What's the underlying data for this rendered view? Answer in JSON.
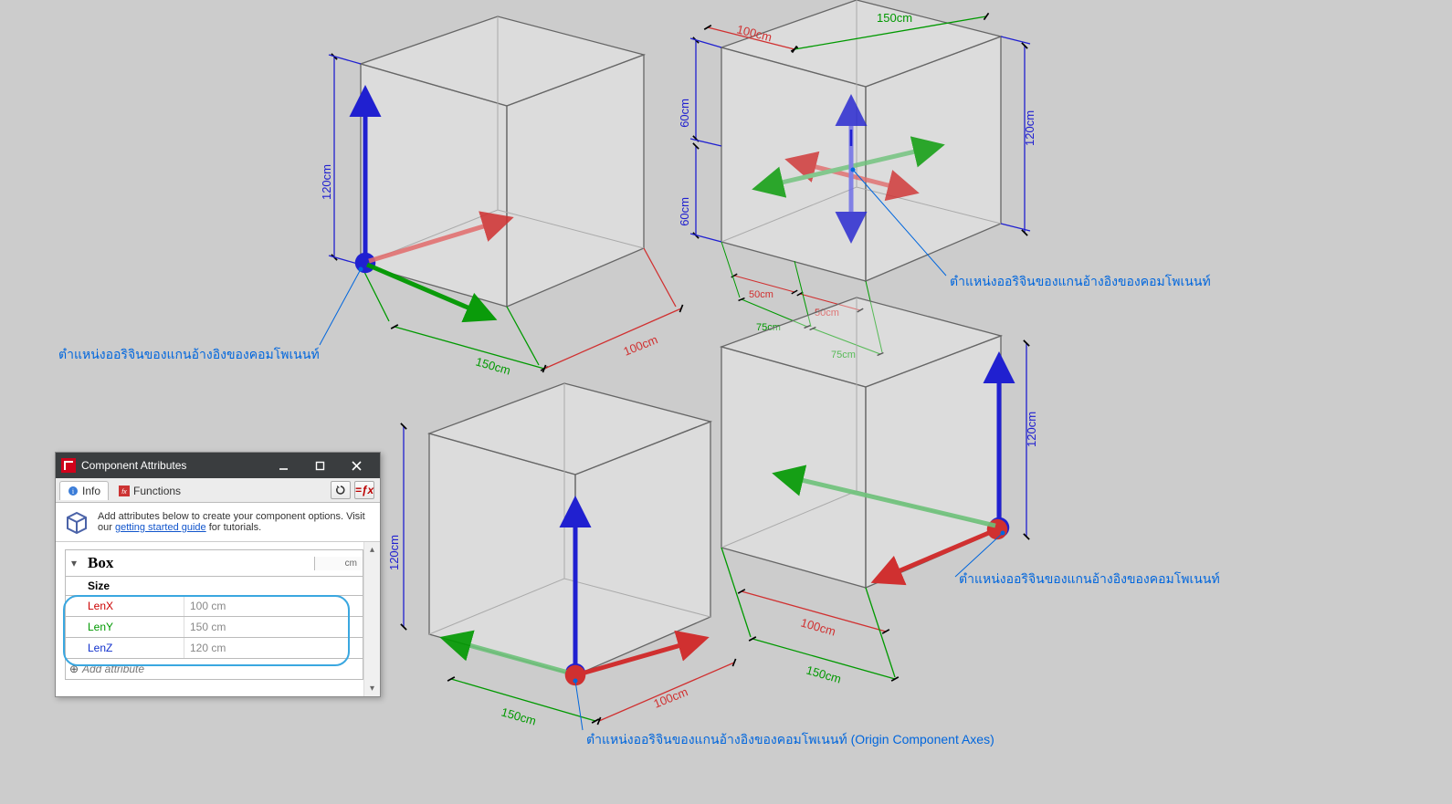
{
  "window": {
    "title": "Component Attributes",
    "tabs": {
      "info": "Info",
      "functions": "Functions"
    },
    "help_prefix": "Add attributes below to create your component options. Visit our ",
    "help_link": "getting started guide",
    "help_suffix": " for tutorials.",
    "component_name": "Box",
    "unit_label": "cm",
    "size_label": "Size",
    "attrs": [
      {
        "key": "LenX",
        "value": "100 cm",
        "color": "#cc0000"
      },
      {
        "key": "LenY",
        "value": "150 cm",
        "color": "#009900"
      },
      {
        "key": "LenZ",
        "value": "120 cm",
        "color": "#1030cc"
      }
    ],
    "add_label": "Add attribute"
  },
  "annotations": {
    "tl": "ตำแหน่งออริจินของแกนอ้างอิงของคอมโพเนนท์",
    "tr": "ตำแหน่งออริจินของแกนอ้างอิงของคอมโพเนนท์",
    "br": "ตำแหน่งออริจินของแกนอ้างอิงของคอมโพเนนท์",
    "bl": "ตำแหน่งออริจินของแกนอ้างอิงของคอมโพเนนท์ (Origin Component Axes)"
  },
  "dimensions": {
    "box_tl": {
      "x": "100cm",
      "y": "150cm",
      "z": "120cm"
    },
    "box_tr": {
      "x": "100cm",
      "y": "150cm",
      "z": "120cm",
      "half_x1": "50cm",
      "half_x2": "50cm",
      "half_y1": "75cm",
      "half_y2": "75cm",
      "half_z1": "60cm",
      "half_z2": "60cm"
    },
    "box_bl": {
      "x": "100cm",
      "y": "150cm",
      "z": "120cm"
    },
    "box_br": {
      "x": "100cm",
      "y": "150cm",
      "z": "120cm"
    }
  }
}
